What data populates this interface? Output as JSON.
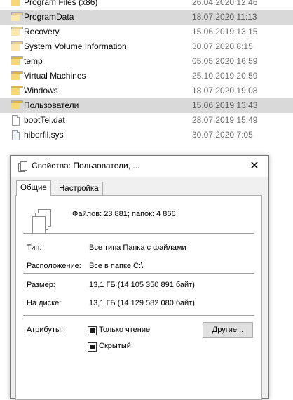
{
  "files": [
    {
      "name": "Program Files (x86)",
      "date": "26.04.2020 12:46",
      "type": "folder",
      "selected": false,
      "pale": false
    },
    {
      "name": "ProgramData",
      "date": "18.07.2020 11:13",
      "type": "folder",
      "selected": true,
      "pale": true
    },
    {
      "name": "Recovery",
      "date": "15.06.2019 13:15",
      "type": "folder",
      "selected": false,
      "pale": true
    },
    {
      "name": "System Volume Information",
      "date": "30.07.2020 8:15",
      "type": "folder",
      "selected": false,
      "pale": true
    },
    {
      "name": "temp",
      "date": "05.05.2020 16:59",
      "type": "folder",
      "selected": false,
      "pale": false
    },
    {
      "name": "Virtual Machines",
      "date": "25.10.2019 20:59",
      "type": "folder",
      "selected": false,
      "pale": false
    },
    {
      "name": "Windows",
      "date": "18.07.2020 19:08",
      "type": "folder",
      "selected": false,
      "pale": false
    },
    {
      "name": "Пользователи",
      "date": "15.06.2019 13:43",
      "type": "folder",
      "selected": true,
      "pale": false
    },
    {
      "name": "bootTel.dat",
      "date": "28.07.2019 15:49",
      "type": "file",
      "selected": false,
      "pale": false
    },
    {
      "name": "hiberfil.sys",
      "date": "30.07.2020 7:05",
      "type": "sys",
      "selected": false,
      "pale": false
    }
  ],
  "dialog": {
    "title": "Свойства: Пользователи, ...",
    "close_glyph": "✕",
    "tabs": [
      "Общие",
      "Настройка"
    ],
    "active_tab": 0,
    "summary": "Файлов: 23 881; папок: 4 866",
    "type_label": "Тип:",
    "type_value": "Все типа Папка с файлами",
    "location_label": "Расположение:",
    "location_value": "Все в папке C:\\",
    "size_label": "Размер:",
    "size_value": "13,1 ГБ (14 105 350 891 байт)",
    "disk_label": "На диске:",
    "disk_value": "13,1 ГБ (14 129 582 080 байт)",
    "attributes_label": "Атрибуты:",
    "readonly_label": "Только чтение",
    "hidden_label": "Скрытый",
    "other_button": "Другие..."
  }
}
